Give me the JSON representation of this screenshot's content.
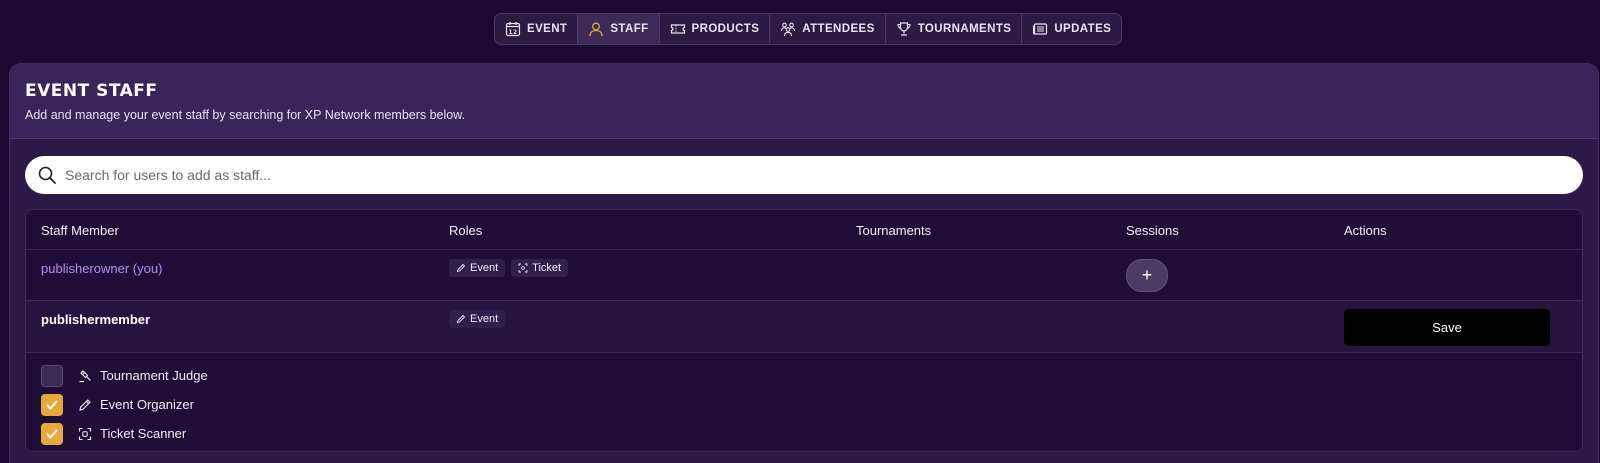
{
  "nav": {
    "tabs": [
      {
        "label": "EVENT",
        "icon": "calendar-icon"
      },
      {
        "label": "STAFF",
        "icon": "user-icon",
        "active": true
      },
      {
        "label": "PRODUCTS",
        "icon": "ticket-icon"
      },
      {
        "label": "ATTENDEES",
        "icon": "group-icon"
      },
      {
        "label": "TOURNAMENTS",
        "icon": "trophy-icon"
      },
      {
        "label": "UPDATES",
        "icon": "newspaper-icon"
      }
    ],
    "calendar_day": "12"
  },
  "colors": {
    "accent": "#e8a93c",
    "you_link": "#b48cf5"
  },
  "header": {
    "title": "EVENT STAFF",
    "subtitle": "Add and manage your event staff by searching for XP Network members below."
  },
  "search": {
    "placeholder": "Search for users to add as staff...",
    "value": ""
  },
  "table": {
    "columns": [
      "Staff Member",
      "Roles",
      "Tournaments",
      "Sessions",
      "Actions"
    ],
    "rows": [
      {
        "name": "publisherowner (you)",
        "roles": [
          "Event",
          "Ticket"
        ],
        "session_button": "+"
      },
      {
        "name": "publishermember",
        "roles": [
          "Event"
        ],
        "action": "Save"
      }
    ]
  },
  "role_editor": [
    {
      "label": "Tournament Judge",
      "checked": false,
      "icon": "gavel-icon"
    },
    {
      "label": "Event Organizer",
      "checked": true,
      "icon": "pencil-icon"
    },
    {
      "label": "Ticket Scanner",
      "checked": true,
      "icon": "scan-icon"
    }
  ]
}
